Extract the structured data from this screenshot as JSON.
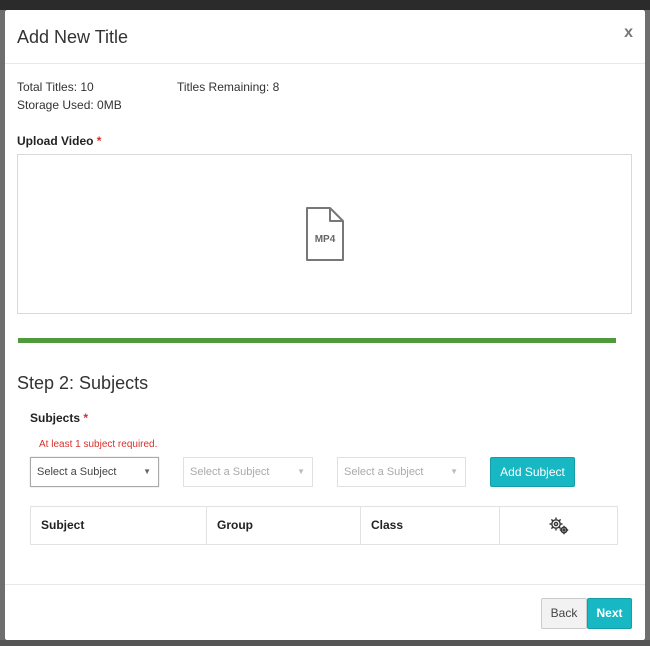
{
  "modal": {
    "title": "Add New Title",
    "close_label": "x"
  },
  "stats": {
    "total_titles": "Total Titles: 10",
    "titles_remaining": "Titles Remaining: 8",
    "storage_used": "Storage Used: 0MB"
  },
  "upload": {
    "label": "Upload Video",
    "required_marker": "*",
    "file_icon": "mp4-file-icon",
    "file_type_text": "MP4"
  },
  "progress": {
    "value_fraction": 1.0,
    "color": "#4f9a3c"
  },
  "step2": {
    "title": "Step 2: Subjects",
    "subjects_label": "Subjects",
    "required_marker": "*",
    "error_text": "At least 1 subject required.",
    "selects": [
      {
        "placeholder": "Select a Subject"
      },
      {
        "placeholder": "Select a Subject"
      },
      {
        "placeholder": "Select a Subject"
      }
    ],
    "add_button": "Add Subject",
    "table_headers": [
      "Subject",
      "Group",
      "Class"
    ],
    "settings_icon": "gears-icon"
  },
  "footer": {
    "back_label": "Back",
    "next_label": "Next"
  },
  "colors": {
    "accent": "#17b8c4",
    "error": "#d9302c",
    "progress": "#4f9a3c"
  }
}
